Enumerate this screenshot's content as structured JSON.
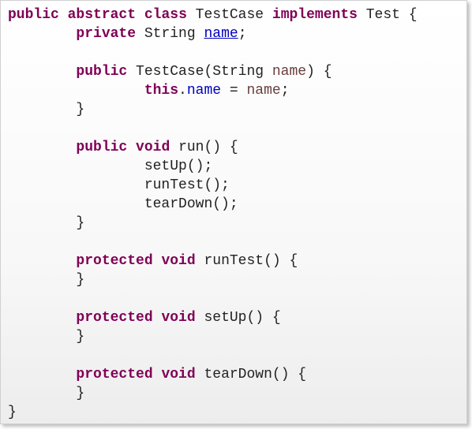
{
  "code": {
    "lines": [
      [
        {
          "text": "public",
          "type": "kw"
        },
        {
          "text": " ",
          "type": "ident"
        },
        {
          "text": "abstract",
          "type": "kw"
        },
        {
          "text": " ",
          "type": "ident"
        },
        {
          "text": "class",
          "type": "kw"
        },
        {
          "text": " TestCase ",
          "type": "ident"
        },
        {
          "text": "implements",
          "type": "kw"
        },
        {
          "text": " Test {",
          "type": "ident"
        }
      ],
      [
        {
          "text": "        ",
          "type": "ident"
        },
        {
          "text": "private",
          "type": "kw"
        },
        {
          "text": " String ",
          "type": "ident"
        },
        {
          "text": "name",
          "type": "field-decl"
        },
        {
          "text": ";",
          "type": "punct"
        }
      ],
      [],
      [
        {
          "text": "        ",
          "type": "ident"
        },
        {
          "text": "public",
          "type": "kw"
        },
        {
          "text": " TestCase(String ",
          "type": "ident"
        },
        {
          "text": "name",
          "type": "param"
        },
        {
          "text": ") {",
          "type": "punct"
        }
      ],
      [
        {
          "text": "                ",
          "type": "ident"
        },
        {
          "text": "this",
          "type": "kw"
        },
        {
          "text": ".",
          "type": "punct"
        },
        {
          "text": "name",
          "type": "field"
        },
        {
          "text": " = ",
          "type": "punct"
        },
        {
          "text": "name",
          "type": "param"
        },
        {
          "text": ";",
          "type": "punct"
        }
      ],
      [
        {
          "text": "        }",
          "type": "punct"
        }
      ],
      [],
      [
        {
          "text": "        ",
          "type": "ident"
        },
        {
          "text": "public",
          "type": "kw"
        },
        {
          "text": " ",
          "type": "ident"
        },
        {
          "text": "void",
          "type": "kw"
        },
        {
          "text": " run() {",
          "type": "ident"
        }
      ],
      [
        {
          "text": "                setUp();",
          "type": "ident"
        }
      ],
      [
        {
          "text": "                runTest();",
          "type": "ident"
        }
      ],
      [
        {
          "text": "                tearDown();",
          "type": "ident"
        }
      ],
      [
        {
          "text": "        }",
          "type": "punct"
        }
      ],
      [],
      [
        {
          "text": "        ",
          "type": "ident"
        },
        {
          "text": "protected",
          "type": "kw"
        },
        {
          "text": " ",
          "type": "ident"
        },
        {
          "text": "void",
          "type": "kw"
        },
        {
          "text": " runTest() {",
          "type": "ident"
        }
      ],
      [
        {
          "text": "        }",
          "type": "punct"
        }
      ],
      [],
      [
        {
          "text": "        ",
          "type": "ident"
        },
        {
          "text": "protected",
          "type": "kw"
        },
        {
          "text": " ",
          "type": "ident"
        },
        {
          "text": "void",
          "type": "kw"
        },
        {
          "text": " setUp() {",
          "type": "ident"
        }
      ],
      [
        {
          "text": "        }",
          "type": "punct"
        }
      ],
      [],
      [
        {
          "text": "        ",
          "type": "ident"
        },
        {
          "text": "protected",
          "type": "kw"
        },
        {
          "text": " ",
          "type": "ident"
        },
        {
          "text": "void",
          "type": "kw"
        },
        {
          "text": " tearDown() {",
          "type": "ident"
        }
      ],
      [
        {
          "text": "        }",
          "type": "punct"
        }
      ],
      [
        {
          "text": "}",
          "type": "punct"
        }
      ]
    ]
  }
}
